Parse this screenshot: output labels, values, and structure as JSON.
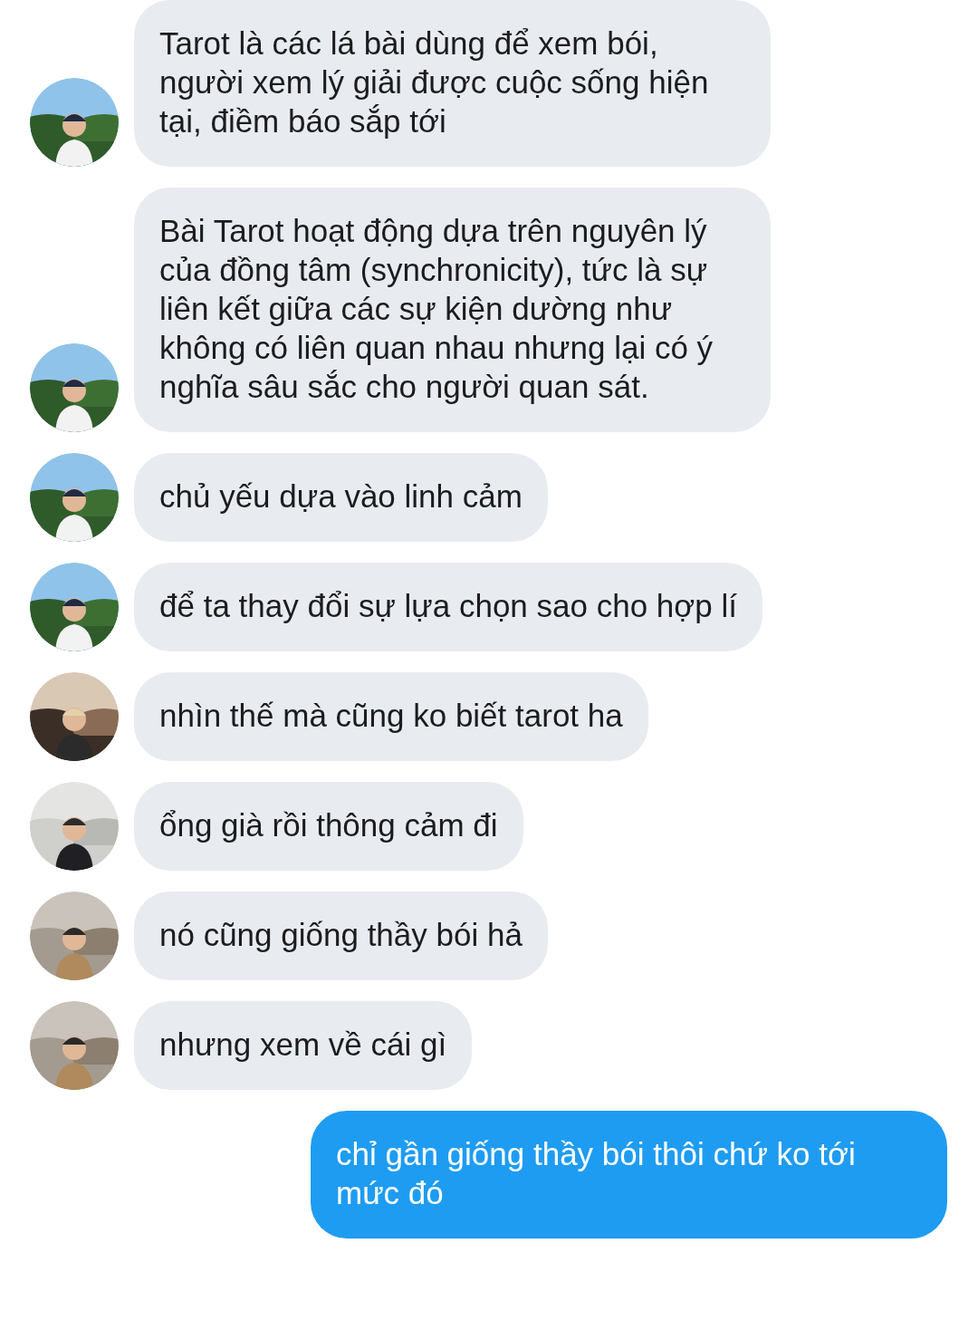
{
  "messages": [
    {
      "kind": "received",
      "text": "Tarot là các lá bài dùng để xem bói, người xem lý giải được cuộc sống hiện tại, điềm báo sắp tới"
    },
    {
      "kind": "received",
      "text": "Bài Tarot hoạt động dựa trên nguyên lý của đồng tâm (synchronicity), tức là sự liên kết giữa các sự kiện dường như không có liên quan nhau nhưng lại có ý nghĩa sâu sắc cho người quan sát."
    },
    {
      "kind": "received",
      "text": "chủ yếu dựa vào linh cảm"
    },
    {
      "kind": "received",
      "text": "để ta thay đổi sự lựa chọn sao cho hợp lí"
    },
    {
      "kind": "received",
      "text": "nhìn thế mà cũng ko biết tarot ha"
    },
    {
      "kind": "received",
      "text": "ổng già rồi thông cảm đi"
    },
    {
      "kind": "received",
      "text": "nó cũng giống thầy bói hả"
    },
    {
      "kind": "received",
      "text": "nhưng xem về cái gì"
    },
    {
      "kind": "sent",
      "text": "chỉ gần giống thầy bói thôi chứ ko tới mức đó"
    }
  ]
}
